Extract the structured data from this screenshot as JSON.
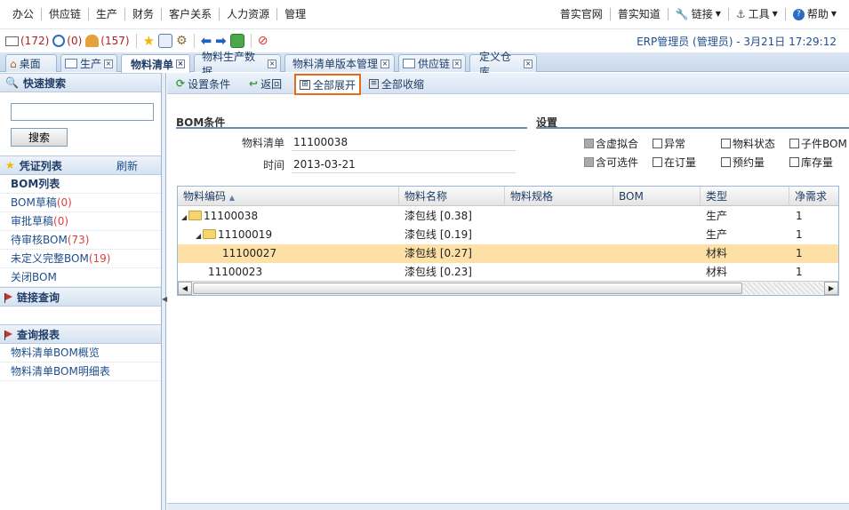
{
  "menu": {
    "left": [
      "办公",
      "供应链",
      "生产",
      "财务",
      "客户关系",
      "人力资源",
      "管理"
    ],
    "right": [
      "普实官网",
      "普实知道",
      "链接",
      "工具",
      "帮助"
    ]
  },
  "toolbar": {
    "mail_count": "(172)",
    "alarm_count": "(0)",
    "users_count": "(157)",
    "user_line": "ERP管理员 (管理员) - 3月21日 17:29:12"
  },
  "tabs": [
    "桌面",
    "生产",
    "物料清单",
    "物料生产数据",
    "物料清单版本管理",
    "供应链",
    "定义仓库"
  ],
  "sidebar": {
    "quick_search": "快速搜索",
    "search_value": "",
    "search_button": "搜索",
    "voucher_list": "凭证列表",
    "refresh": "刷新",
    "items": [
      {
        "label": "BOM列表",
        "count": ""
      },
      {
        "label": "BOM草稿",
        "count": "(0)"
      },
      {
        "label": "审批草稿",
        "count": "(0)"
      },
      {
        "label": "待审核BOM",
        "count": "(73)"
      },
      {
        "label": "未定义完整BOM",
        "count": "(19)"
      },
      {
        "label": "关闭BOM",
        "count": ""
      }
    ],
    "link_query": "链接查询",
    "report_query": "查询报表",
    "reports": [
      "物料清单BOM概览",
      "物料清单BOM明细表"
    ]
  },
  "content": {
    "buttons": [
      "设置条件",
      "返回",
      "全部展开",
      "全部收缩"
    ],
    "bom_section": "BOM条件",
    "settings_section": "设置",
    "bom_label": "物料清单",
    "bom_value": "11100038",
    "time_label": "时间",
    "time_value": "2013-03-21",
    "checks": [
      "含虚拟合",
      "异常",
      "物料状态",
      "子件BOM",
      "含可选件",
      "在订量",
      "预约量",
      "库存量"
    ]
  },
  "grid": {
    "columns": [
      "物料编码",
      "物料名称",
      "物料规格",
      "BOM",
      "类型",
      "净需求"
    ],
    "rows": [
      {
        "code": "11100038",
        "name": "漆包线 [0.38]",
        "spec": "",
        "bom": "",
        "type": "生产",
        "need": "1"
      },
      {
        "code": "11100019",
        "name": "漆包线 [0.19]",
        "spec": "",
        "bom": "",
        "type": "生产",
        "need": "1"
      },
      {
        "code": "11100027",
        "name": "漆包线 [0.27]",
        "spec": "",
        "bom": "",
        "type": "材料",
        "need": "1"
      },
      {
        "code": "11100023",
        "name": "漆包线 [0.23]",
        "spec": "",
        "bom": "",
        "type": "材料",
        "need": "1"
      }
    ]
  },
  "colors": {
    "highlight_row": "#fde0a6",
    "highlight_button": "#e46b1c"
  }
}
